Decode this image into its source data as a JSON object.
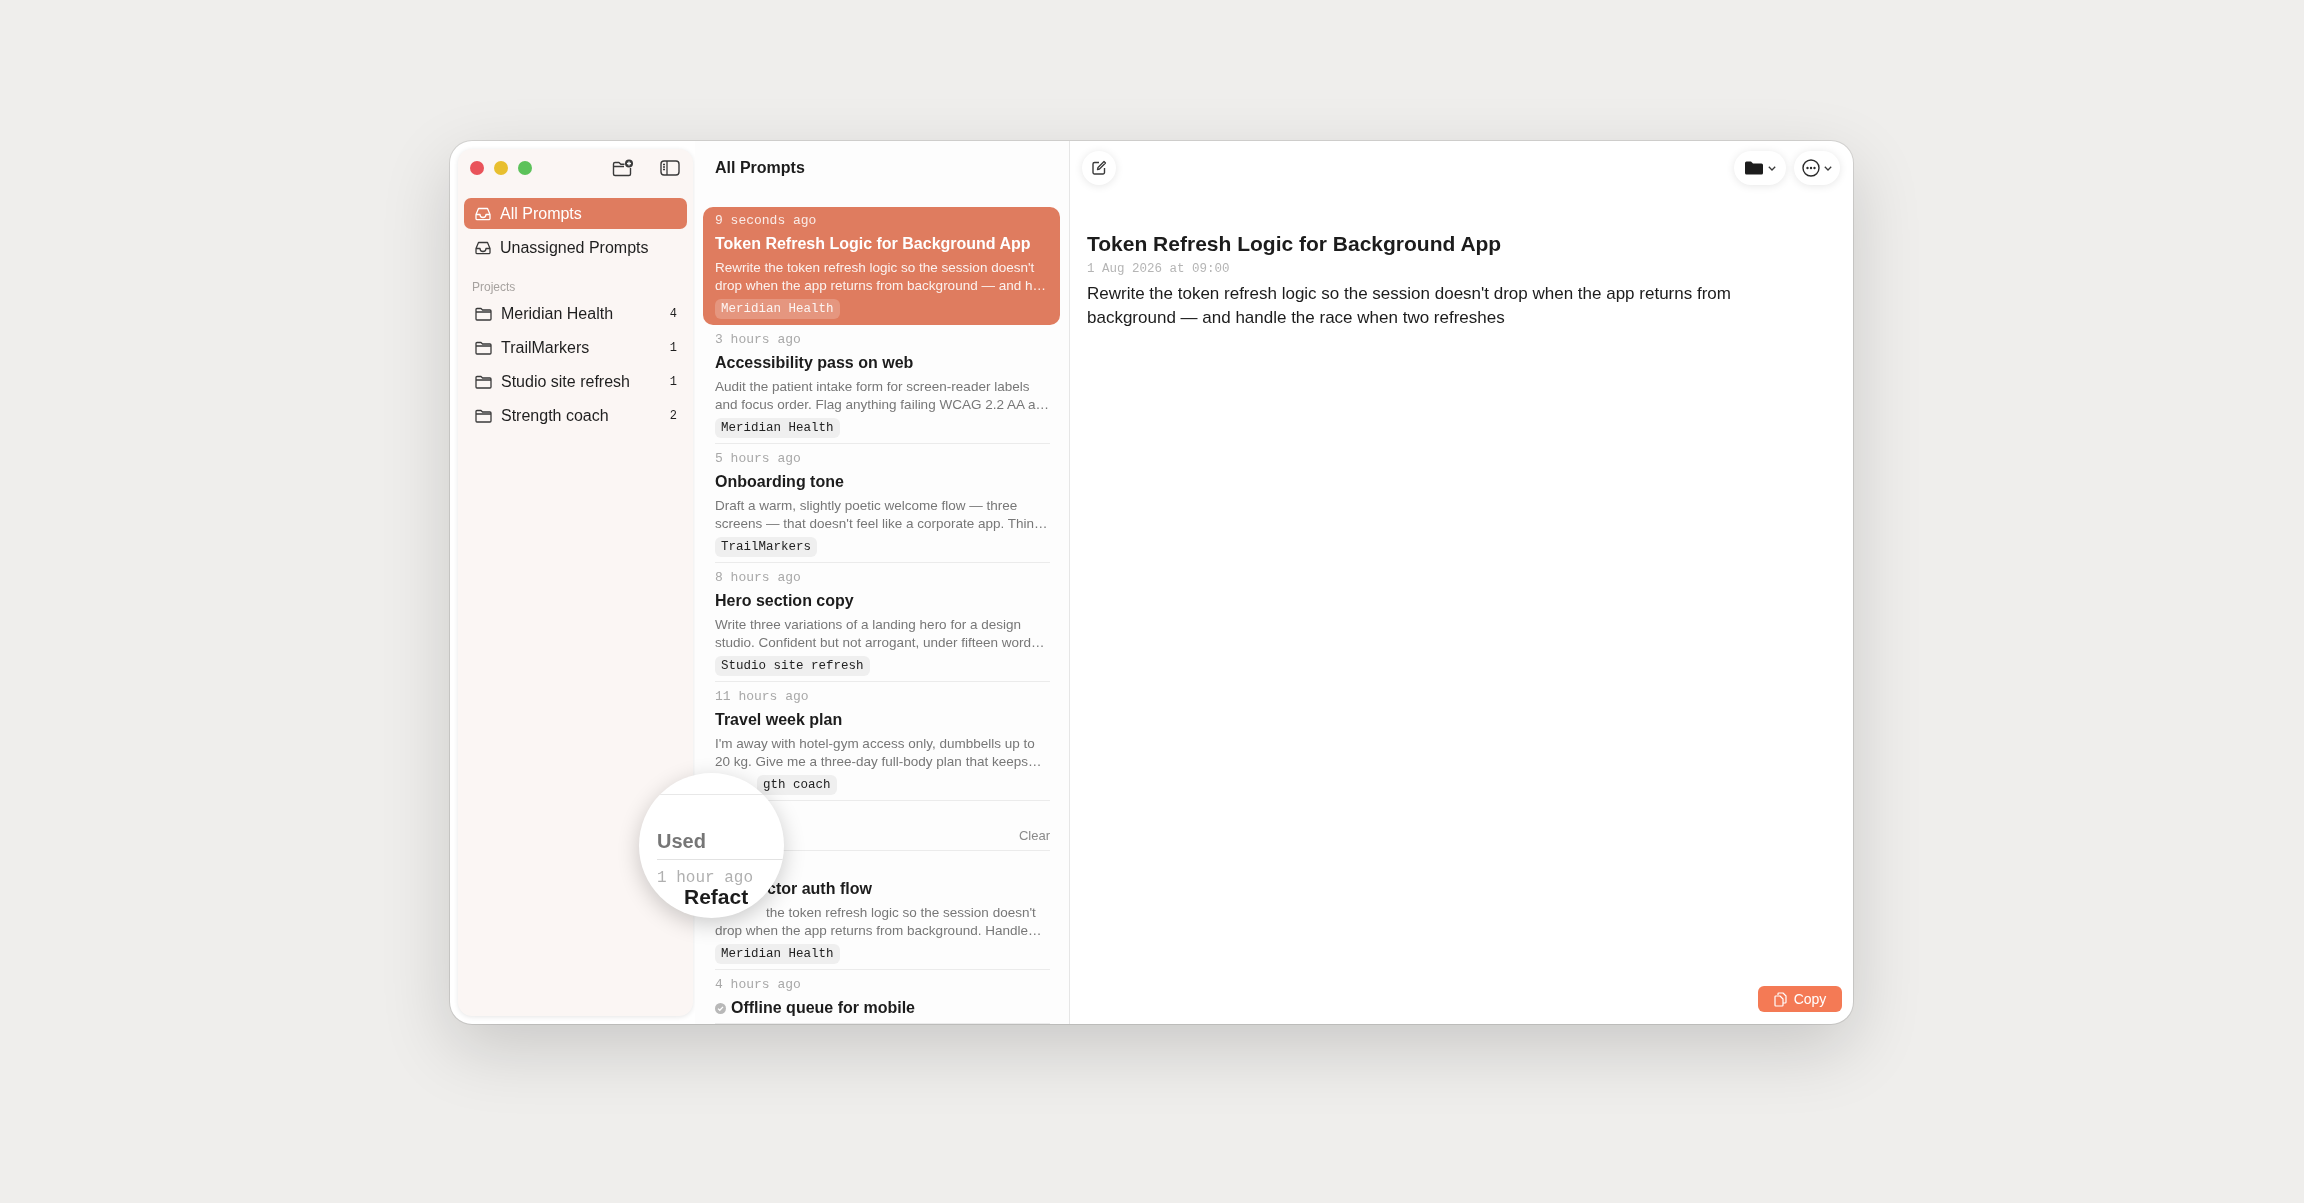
{
  "sidebar": {
    "items": [
      {
        "label": "All Prompts",
        "selected": true
      },
      {
        "label": "Unassigned Prompts",
        "selected": false
      }
    ],
    "section_label": "Projects",
    "projects": [
      {
        "label": "Meridian Health",
        "count": "4",
        "selected": false
      },
      {
        "label": "TrailMarkers",
        "count": "1",
        "selected": false
      },
      {
        "label": "Studio site refresh",
        "count": "1",
        "selected": false
      },
      {
        "label": "Strength coach",
        "count": "2",
        "selected": false
      }
    ]
  },
  "list": {
    "title": "All Prompts",
    "prompts": [
      {
        "kind": "full",
        "time": "9 seconds ago",
        "title": "Token Refresh Logic for Background App",
        "preview_lines": [
          "Rewrite the token refresh logic so the session doesn't",
          "drop when the app returns from background — and h…"
        ],
        "tag": "Meridian Health",
        "selected": true
      },
      {
        "kind": "full",
        "time": "3 hours ago",
        "title": "Accessibility pass on web",
        "preview_lines": [
          "Audit the patient intake form for screen-reader labels",
          "and focus order. Flag anything failing WCAG 2.2 AA a…"
        ],
        "tag": "Meridian Health",
        "selected": false
      },
      {
        "kind": "full",
        "time": "5 hours ago",
        "title": "Onboarding tone",
        "preview_lines": [
          "Draft a warm, slightly poetic welcome flow — three",
          "screens — that doesn't feel like a corporate app. Thin…"
        ],
        "tag": "TrailMarkers",
        "selected": false
      },
      {
        "kind": "full",
        "time": "8 hours ago",
        "title": "Hero section copy",
        "preview_lines": [
          "Write three variations of a landing hero for a design",
          "studio. Confident but not arrogant, under fifteen word…"
        ],
        "tag": "Studio site refresh",
        "selected": false
      },
      {
        "kind": "tag_cut",
        "time": "11 hours ago",
        "title": "Travel week plan",
        "preview_lines": [
          "I'm away with hotel-gym access only, dumbbells up to",
          "20 kg. Give me a three-day full-body plan that keeps…"
        ],
        "tag": "gth coach",
        "selected": false
      }
    ],
    "used": {
      "clear_button": "Clear",
      "prompts": [
        {
          "kind": "title_cut",
          "title": "ctor auth flow",
          "preview_lines": [
            "the token refresh logic so the session doesn't",
            "drop when the app returns from background. Handle…"
          ],
          "tag": "Meridian Health",
          "used_mark": false,
          "selected": false
        },
        {
          "kind": "full",
          "time": "4 hours ago",
          "title": "Offline queue for mobile",
          "used_mark": true,
          "selected": false
        }
      ]
    }
  },
  "magnifier": {
    "heading": "Used",
    "time": "1 hour ago",
    "title": "Refact"
  },
  "detail": {
    "title": "Token Refresh Logic for Background App",
    "date": "1 Aug 2026 at 09:00",
    "body": "Rewrite the token refresh logic so the session doesn't drop when the app returns from background — and handle the race when two refreshes",
    "copy_button": "Copy"
  }
}
